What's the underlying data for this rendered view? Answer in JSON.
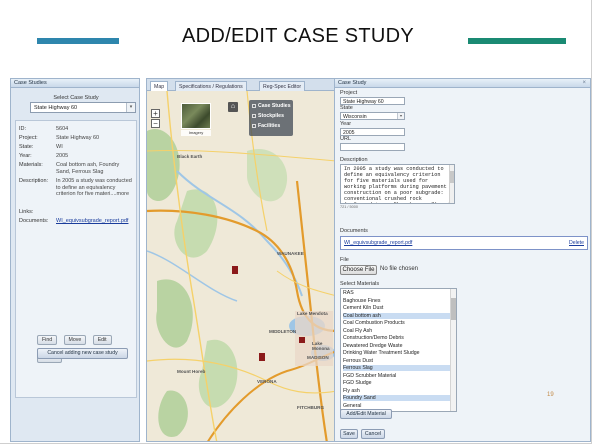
{
  "slide": {
    "title": "ADD/EDIT CASE STUDY",
    "page_number": "19",
    "accent_left": "#2e86ad",
    "accent_right": "#1a8a73"
  },
  "case_studies_panel": {
    "header": "Case Studies",
    "select_label": "Select Case Study",
    "selected_case": "State Highway 60",
    "details": {
      "id_label": "ID:",
      "id_value": "5604",
      "project_label": "Project:",
      "project_value": "State Highway 60",
      "state_label": "State:",
      "state_value": "WI",
      "year_label": "Year:",
      "year_value": "2005",
      "materials_label": "Materials:",
      "materials_value": "Coal bottom ash, Foundry Sand, Ferrous Slag",
      "description_label": "Description:",
      "description_value": "In 2005 a study was conducted to define an equivalency criterion for five materi....more",
      "links_label": "Links:",
      "documents_label": "Documents:",
      "documents_value": "WI_equivsubgrade_report.pdf"
    },
    "buttons": {
      "find": "Find",
      "move": "Move",
      "edit": "Edit",
      "delete": "Delete",
      "cancel_add": "Cancel adding new case study"
    }
  },
  "map_panel": {
    "tabs": [
      "Map",
      "Specifications / Regulations",
      "Reg-Spec Editor"
    ],
    "active_tab": "Map",
    "imagery_label": "Imagery",
    "layers": [
      "Case Studies",
      "Stockpiles",
      "Facilities"
    ],
    "place_labels": [
      "Black Earth",
      "WAUNAKEE",
      "MADISON",
      "Lake Mendota",
      "Lake Monona",
      "MIDDLETON",
      "VERONA",
      "FITCHBURG",
      "Mount Horeb"
    ],
    "colors": {
      "land": "#efe9d8",
      "forest": "#b9d3a2",
      "water": "#9fc6e6",
      "highway": "#e39b2c",
      "road": "#f5d16a",
      "marker": "#8b1a1a"
    }
  },
  "case_study_form": {
    "header": "Case Study",
    "close_icon": "close-icon",
    "project_label": "Project",
    "project_value": "State Highway 60",
    "state_label": "State",
    "state_value": "Wisconsin",
    "year_label": "Year",
    "year_value": "2005",
    "url_label": "URL",
    "url_value": "",
    "description_label": "Description",
    "description_value": "In 2005 a study was conducted to define an equivalency criterion for five materials used for working platforms during pavement construction on a poor subgrade: conventional crushed rock (referred to as \"breaker run\") and four alternatives (i.e.",
    "char_count": "721 / 5000",
    "documents_label": "Documents",
    "documents_value": "WI_equivsubgrade_report.pdf",
    "delete_label": "Delete",
    "file_label": "File",
    "choose_file_label": "Choose File",
    "no_file_label": "No file chosen",
    "select_materials_label": "Select Materials",
    "materials": [
      {
        "name": "RAS",
        "selected": false
      },
      {
        "name": "Baghouse Fines",
        "selected": false
      },
      {
        "name": "Cement Kiln Dust",
        "selected": false
      },
      {
        "name": "Coal bottom ash",
        "selected": true
      },
      {
        "name": "Coal Combustion Products",
        "selected": false
      },
      {
        "name": "Coal Fly Ash",
        "selected": false
      },
      {
        "name": "Construction/Demo Debris",
        "selected": false
      },
      {
        "name": "Dewatered Dredge Waste",
        "selected": false
      },
      {
        "name": "Drinking Water Treatment Sludge",
        "selected": false
      },
      {
        "name": "Ferrous Dust",
        "selected": false
      },
      {
        "name": "Ferrous Slag",
        "selected": true
      },
      {
        "name": "FGD Scrubber Material",
        "selected": false
      },
      {
        "name": "FGD Sludge",
        "selected": false
      },
      {
        "name": "Fly ash",
        "selected": false
      },
      {
        "name": "Foundry Sand",
        "selected": true
      },
      {
        "name": "General",
        "selected": false
      }
    ],
    "add_material_label": "Add/Edit Material",
    "save_label": "Save",
    "cancel_label": "Cancel"
  }
}
